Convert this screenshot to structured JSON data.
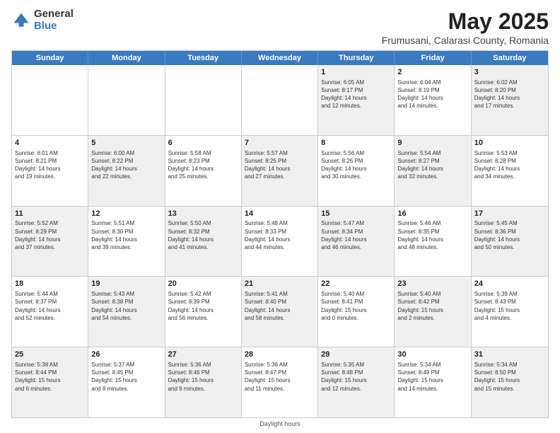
{
  "header": {
    "logo_general": "General",
    "logo_blue": "Blue",
    "title": "May 2025",
    "subtitle": "Frumusani, Calarasi County, Romania"
  },
  "calendar": {
    "days_of_week": [
      "Sunday",
      "Monday",
      "Tuesday",
      "Wednesday",
      "Thursday",
      "Friday",
      "Saturday"
    ],
    "weeks": [
      [
        {
          "num": "",
          "info": ""
        },
        {
          "num": "",
          "info": ""
        },
        {
          "num": "",
          "info": ""
        },
        {
          "num": "",
          "info": ""
        },
        {
          "num": "1",
          "info": "Sunrise: 6:05 AM\nSunset: 8:17 PM\nDaylight: 14 hours\nand 12 minutes."
        },
        {
          "num": "2",
          "info": "Sunrise: 6:04 AM\nSunset: 8:19 PM\nDaylight: 14 hours\nand 14 minutes."
        },
        {
          "num": "3",
          "info": "Sunrise: 6:02 AM\nSunset: 8:20 PM\nDaylight: 14 hours\nand 17 minutes."
        }
      ],
      [
        {
          "num": "4",
          "info": "Sunrise: 6:01 AM\nSunset: 8:21 PM\nDaylight: 14 hours\nand 19 minutes."
        },
        {
          "num": "5",
          "info": "Sunrise: 6:00 AM\nSunset: 8:22 PM\nDaylight: 14 hours\nand 22 minutes."
        },
        {
          "num": "6",
          "info": "Sunrise: 5:58 AM\nSunset: 8:23 PM\nDaylight: 14 hours\nand 25 minutes."
        },
        {
          "num": "7",
          "info": "Sunrise: 5:57 AM\nSunset: 8:25 PM\nDaylight: 14 hours\nand 27 minutes."
        },
        {
          "num": "8",
          "info": "Sunrise: 5:56 AM\nSunset: 8:26 PM\nDaylight: 14 hours\nand 30 minutes."
        },
        {
          "num": "9",
          "info": "Sunrise: 5:54 AM\nSunset: 8:27 PM\nDaylight: 14 hours\nand 32 minutes."
        },
        {
          "num": "10",
          "info": "Sunrise: 5:53 AM\nSunset: 8:28 PM\nDaylight: 14 hours\nand 34 minutes."
        }
      ],
      [
        {
          "num": "11",
          "info": "Sunrise: 5:52 AM\nSunset: 8:29 PM\nDaylight: 14 hours\nand 37 minutes."
        },
        {
          "num": "12",
          "info": "Sunrise: 5:51 AM\nSunset: 8:30 PM\nDaylight: 14 hours\nand 39 minutes."
        },
        {
          "num": "13",
          "info": "Sunrise: 5:50 AM\nSunset: 8:32 PM\nDaylight: 14 hours\nand 41 minutes."
        },
        {
          "num": "14",
          "info": "Sunrise: 5:48 AM\nSunset: 8:33 PM\nDaylight: 14 hours\nand 44 minutes."
        },
        {
          "num": "15",
          "info": "Sunrise: 5:47 AM\nSunset: 8:34 PM\nDaylight: 14 hours\nand 46 minutes."
        },
        {
          "num": "16",
          "info": "Sunrise: 5:46 AM\nSunset: 8:35 PM\nDaylight: 14 hours\nand 48 minutes."
        },
        {
          "num": "17",
          "info": "Sunrise: 5:45 AM\nSunset: 8:36 PM\nDaylight: 14 hours\nand 50 minutes."
        }
      ],
      [
        {
          "num": "18",
          "info": "Sunrise: 5:44 AM\nSunset: 8:37 PM\nDaylight: 14 hours\nand 52 minutes."
        },
        {
          "num": "19",
          "info": "Sunrise: 5:43 AM\nSunset: 8:38 PM\nDaylight: 14 hours\nand 54 minutes."
        },
        {
          "num": "20",
          "info": "Sunrise: 5:42 AM\nSunset: 8:39 PM\nDaylight: 14 hours\nand 56 minutes."
        },
        {
          "num": "21",
          "info": "Sunrise: 5:41 AM\nSunset: 8:40 PM\nDaylight: 14 hours\nand 58 minutes."
        },
        {
          "num": "22",
          "info": "Sunrise: 5:40 AM\nSunset: 8:41 PM\nDaylight: 15 hours\nand 0 minutes."
        },
        {
          "num": "23",
          "info": "Sunrise: 5:40 AM\nSunset: 8:42 PM\nDaylight: 15 hours\nand 2 minutes."
        },
        {
          "num": "24",
          "info": "Sunrise: 5:39 AM\nSunset: 8:43 PM\nDaylight: 15 hours\nand 4 minutes."
        }
      ],
      [
        {
          "num": "25",
          "info": "Sunrise: 5:38 AM\nSunset: 8:44 PM\nDaylight: 15 hours\nand 6 minutes."
        },
        {
          "num": "26",
          "info": "Sunrise: 5:37 AM\nSunset: 8:45 PM\nDaylight: 15 hours\nand 8 minutes."
        },
        {
          "num": "27",
          "info": "Sunrise: 5:36 AM\nSunset: 8:46 PM\nDaylight: 15 hours\nand 9 minutes."
        },
        {
          "num": "28",
          "info": "Sunrise: 5:36 AM\nSunset: 8:47 PM\nDaylight: 15 hours\nand 11 minutes."
        },
        {
          "num": "29",
          "info": "Sunrise: 5:35 AM\nSunset: 8:48 PM\nDaylight: 15 hours\nand 12 minutes."
        },
        {
          "num": "30",
          "info": "Sunrise: 5:34 AM\nSunset: 8:49 PM\nDaylight: 15 hours\nand 14 minutes."
        },
        {
          "num": "31",
          "info": "Sunrise: 5:34 AM\nSunset: 8:50 PM\nDaylight: 15 hours\nand 15 minutes."
        }
      ]
    ]
  },
  "footer": {
    "note": "Daylight hours"
  }
}
